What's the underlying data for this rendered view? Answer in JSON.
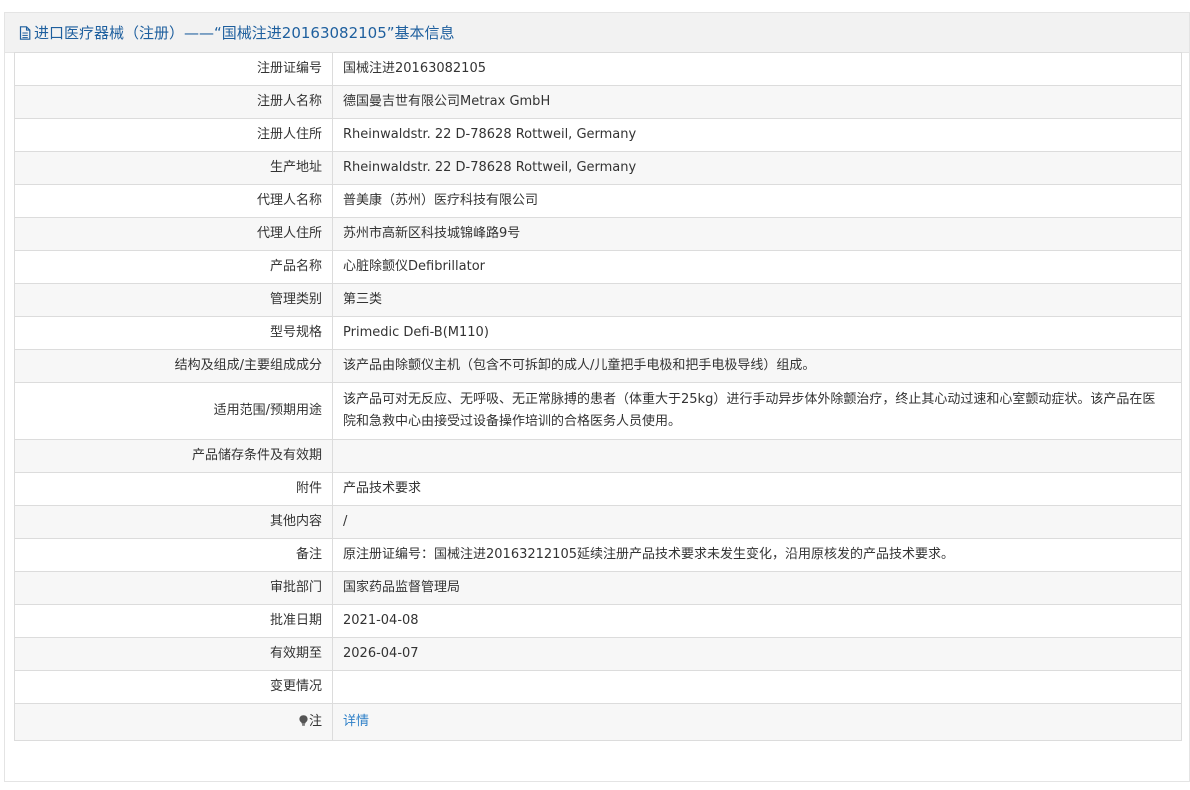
{
  "header": {
    "title": "进口医疗器械（注册）——“国械注进20163082105”基本信息"
  },
  "rows": [
    {
      "label": "注册证编号",
      "value": "国械注进20163082105"
    },
    {
      "label": "注册人名称",
      "value": "德国曼吉世有限公司Metrax GmbH"
    },
    {
      "label": "注册人住所",
      "value": "Rheinwaldstr. 22 D-78628 Rottweil, Germany"
    },
    {
      "label": "生产地址",
      "value": "Rheinwaldstr. 22 D-78628 Rottweil, Germany"
    },
    {
      "label": "代理人名称",
      "value": "普美康（苏州）医疗科技有限公司"
    },
    {
      "label": "代理人住所",
      "value": "苏州市高新区科技城锦峰路9号"
    },
    {
      "label": "产品名称",
      "value": "心脏除颤仪Defibrillator"
    },
    {
      "label": "管理类别",
      "value": "第三类"
    },
    {
      "label": "型号规格",
      "value": "Primedic Defi-B(M110)"
    },
    {
      "label": "结构及组成/主要组成成分",
      "value": "该产品由除颤仪主机（包含不可拆卸的成人/儿童把手电极和把手电极导线）组成。"
    },
    {
      "label": "适用范围/预期用途",
      "value": "该产品可对无反应、无呼吸、无正常脉搏的患者（体重大于25kg）进行手动异步体外除颤治疗，终止其心动过速和心室颤动症状。该产品在医院和急救中心由接受过设备操作培训的合格医务人员使用。"
    },
    {
      "label": "产品储存条件及有效期",
      "value": ""
    },
    {
      "label": "附件",
      "value": "产品技术要求"
    },
    {
      "label": "其他内容",
      "value": "/"
    },
    {
      "label": "备注",
      "value": "原注册证编号：国械注进20163212105延续注册产品技术要求未发生变化，沿用原核发的产品技术要求。"
    },
    {
      "label": "审批部门",
      "value": "国家药品监督管理局"
    },
    {
      "label": "批准日期",
      "value": "2021-04-08"
    },
    {
      "label": "有效期至",
      "value": "2026-04-07"
    },
    {
      "label": "变更情况",
      "value": ""
    }
  ],
  "note_row": {
    "label": "注",
    "link_text": "详情"
  },
  "colors": {
    "header_text": "#1e5f9e",
    "link": "#2f80c8",
    "header_bg": "#f2f2f2",
    "border": "#dcdcdc"
  }
}
